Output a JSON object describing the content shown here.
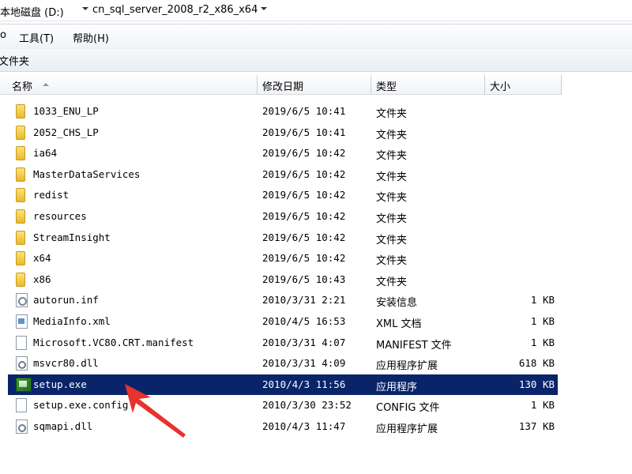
{
  "address": {
    "crumb1": "本地磁盘 (D:)",
    "crumb2": "cn_sql_server_2008_r2_x86_x64"
  },
  "menu": {
    "stub": "o",
    "tools": "工具(T)",
    "help": "帮助(H)"
  },
  "toolbar": {
    "new_folder": "文件夹"
  },
  "columns": {
    "name": "名称",
    "date": "修改日期",
    "type": "类型",
    "size": "大小"
  },
  "files": [
    {
      "name": "1033_ENU_LP",
      "date": "2019/6/5 10:41",
      "type": "文件夹",
      "size": "",
      "icon": "folder-icon"
    },
    {
      "name": "2052_CHS_LP",
      "date": "2019/6/5 10:41",
      "type": "文件夹",
      "size": "",
      "icon": "folder-icon"
    },
    {
      "name": "ia64",
      "date": "2019/6/5 10:42",
      "type": "文件夹",
      "size": "",
      "icon": "folder-icon"
    },
    {
      "name": "MasterDataServices",
      "date": "2019/6/5 10:42",
      "type": "文件夹",
      "size": "",
      "icon": "folder-icon"
    },
    {
      "name": "redist",
      "date": "2019/6/5 10:42",
      "type": "文件夹",
      "size": "",
      "icon": "folder-icon"
    },
    {
      "name": "resources",
      "date": "2019/6/5 10:42",
      "type": "文件夹",
      "size": "",
      "icon": "folder-icon"
    },
    {
      "name": "StreamInsight",
      "date": "2019/6/5 10:42",
      "type": "文件夹",
      "size": "",
      "icon": "folder-icon"
    },
    {
      "name": "x64",
      "date": "2019/6/5 10:42",
      "type": "文件夹",
      "size": "",
      "icon": "folder-icon"
    },
    {
      "name": "x86",
      "date": "2019/6/5 10:43",
      "type": "文件夹",
      "size": "",
      "icon": "folder-icon"
    },
    {
      "name": "autorun.inf",
      "date": "2010/3/31 2:21",
      "type": "安装信息",
      "size": "1 KB",
      "icon": "setup-info-icon"
    },
    {
      "name": "MediaInfo.xml",
      "date": "2010/4/5 16:53",
      "type": "XML 文档",
      "size": "1 KB",
      "icon": "xml-document-icon"
    },
    {
      "name": "Microsoft.VC80.CRT.manifest",
      "date": "2010/3/31 4:07",
      "type": "MANIFEST 文件",
      "size": "1 KB",
      "icon": "file-icon"
    },
    {
      "name": "msvcr80.dll",
      "date": "2010/3/31 4:09",
      "type": "应用程序扩展",
      "size": "618 KB",
      "icon": "dll-icon"
    },
    {
      "name": "setup.exe",
      "date": "2010/4/3 11:56",
      "type": "应用程序",
      "size": "130 KB",
      "icon": "setup-exe-icon",
      "selected": true
    },
    {
      "name": "setup.exe.config",
      "date": "2010/3/30 23:52",
      "type": "CONFIG 文件",
      "size": "1 KB",
      "icon": "file-icon"
    },
    {
      "name": "sqmapi.dll",
      "date": "2010/4/3 11:47",
      "type": "应用程序扩展",
      "size": "137 KB",
      "icon": "dll-icon"
    }
  ],
  "colors": {
    "selection": "#0a246a",
    "annotation_arrow": "#e8322c"
  }
}
